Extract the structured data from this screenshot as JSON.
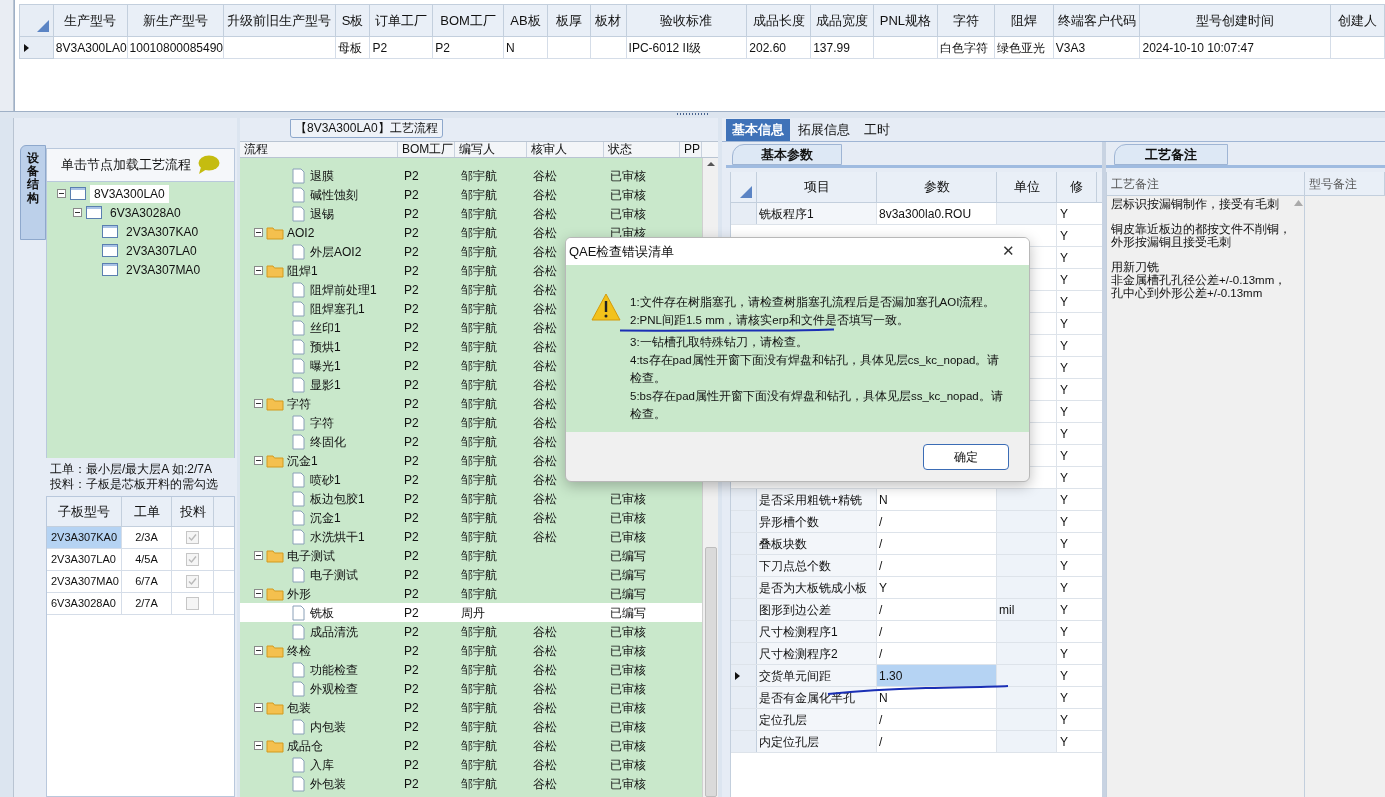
{
  "top_grid": {
    "columns": [
      "生产型号",
      "新生产型号",
      "升级前旧生产型号",
      "S板",
      "订单工厂",
      "BOM工厂",
      "AB板",
      "板厚",
      "板材",
      "验收标准",
      "成品长度",
      "成品宽度",
      "PNL规格",
      "字符",
      "阻焊",
      "终端客户代码",
      "型号创建时间",
      "创建人"
    ],
    "rows": [
      {
        "selected": true,
        "cells": [
          "8V3A300LA0",
          "10010800085490",
          null,
          "母板",
          "P2",
          "P2",
          "N",
          null,
          null,
          "IPC-6012 II级",
          "202.60",
          "137.99",
          null,
          "白色字符",
          "绿色亚光",
          "V3A3",
          "2024-10-10 10:07:47",
          null
        ]
      }
    ]
  },
  "structure": {
    "tab": "设备结构",
    "hint": "单击节点加载工艺流程",
    "tree": [
      {
        "label": "8V3A300LA0",
        "selected": true,
        "expanded": true,
        "children": [
          {
            "label": "6V3A3028A0",
            "selected": false,
            "expanded": true,
            "children": [
              {
                "label": "2V3A307KA0",
                "selected": false
              },
              {
                "label": "2V3A307LA0",
                "selected": false
              },
              {
                "label": "2V3A307MA0",
                "selected": false
              }
            ]
          }
        ]
      }
    ],
    "info": [
      "工单：最小层/最大层A 如:2/7A",
      "投料：子板是芯板开料的需勾选"
    ],
    "grid": {
      "columns": [
        "子板型号",
        "工单",
        "投料"
      ],
      "rows": [
        {
          "model": "2V3A307KA0",
          "order": "2/3A",
          "checked": true,
          "disabled": true,
          "selected": true
        },
        {
          "model": "2V3A307LA0",
          "order": "4/5A",
          "checked": true,
          "disabled": true,
          "selected": false
        },
        {
          "model": "2V3A307MA0",
          "order": "6/7A",
          "checked": true,
          "disabled": true,
          "selected": false
        },
        {
          "model": "6V3A3028A0",
          "order": "2/7A",
          "checked": false,
          "disabled": true,
          "selected": false
        }
      ]
    }
  },
  "process": {
    "title": "【8V3A300LA0】工艺流程",
    "columns": [
      "流程",
      "BOM工厂",
      "编写人",
      "核审人",
      "状态",
      "PP"
    ],
    "groups": [
      {
        "children": [
          {
            "name": "退膜",
            "bom": "P2",
            "author": "邹宇航",
            "reviewer": "谷松",
            "status": "已审核",
            "selected": false
          },
          {
            "name": "碱性蚀刻",
            "bom": "P2",
            "author": "邹宇航",
            "reviewer": "谷松",
            "status": "已审核",
            "selected": false
          },
          {
            "name": "退锡",
            "bom": "P2",
            "author": "邹宇航",
            "reviewer": "谷松",
            "status": "已审核",
            "selected": false
          }
        ]
      },
      {
        "name": "AOI2",
        "expanded": true,
        "bom": "P2",
        "author": "邹宇航",
        "reviewer": "谷松",
        "status": "已审核",
        "selected": false,
        "children": [
          {
            "name": "外层AOI2",
            "bom": "P2",
            "author": "邹宇航",
            "reviewer": "谷松",
            "selected": false
          }
        ]
      },
      {
        "name": "阻焊1",
        "expanded": true,
        "bom": "P2",
        "author": "邹宇航",
        "reviewer": "谷松",
        "selected": false,
        "children": [
          {
            "name": "阻焊前处理1",
            "bom": "P2",
            "author": "邹宇航",
            "reviewer": "谷松",
            "selected": false
          },
          {
            "name": "阻焊塞孔1",
            "bom": "P2",
            "author": "邹宇航",
            "reviewer": "谷松",
            "selected": false
          },
          {
            "name": "丝印1",
            "bom": "P2",
            "author": "邹宇航",
            "reviewer": "谷松",
            "selected": false
          },
          {
            "name": "预烘1",
            "bom": "P2",
            "author": "邹宇航",
            "reviewer": "谷松",
            "selected": false
          },
          {
            "name": "曝光1",
            "bom": "P2",
            "author": "邹宇航",
            "reviewer": "谷松",
            "selected": false
          },
          {
            "name": "显影1",
            "bom": "P2",
            "author": "邹宇航",
            "reviewer": "谷松",
            "selected": false
          }
        ]
      },
      {
        "name": "字符",
        "expanded": true,
        "bom": "P2",
        "author": "邹宇航",
        "reviewer": "谷松",
        "selected": false,
        "children": [
          {
            "name": "字符",
            "bom": "P2",
            "author": "邹宇航",
            "reviewer": "谷松",
            "selected": false
          },
          {
            "name": "终固化",
            "bom": "P2",
            "author": "邹宇航",
            "reviewer": "谷松",
            "selected": false
          }
        ]
      },
      {
        "name": "沉金1",
        "expanded": true,
        "bom": "P2",
        "author": "邹宇航",
        "reviewer": "谷松",
        "selected": false,
        "children": [
          {
            "name": "喷砂1",
            "bom": "P2",
            "author": "邹宇航",
            "reviewer": "谷松",
            "selected": false
          },
          {
            "name": "板边包胶1",
            "bom": "P2",
            "author": "邹宇航",
            "reviewer": "谷松",
            "status": "已审核",
            "selected": false
          },
          {
            "name": "沉金1",
            "bom": "P2",
            "author": "邹宇航",
            "reviewer": "谷松",
            "status": "已审核",
            "selected": false
          },
          {
            "name": "水洗烘干1",
            "bom": "P2",
            "author": "邹宇航",
            "reviewer": "谷松",
            "status": "已审核",
            "selected": false
          }
        ]
      },
      {
        "name": "电子测试",
        "expanded": true,
        "bom": "P2",
        "author": "邹宇航",
        "status": "已编写",
        "selected": false,
        "children": [
          {
            "name": "电子测试",
            "bom": "P2",
            "author": "邹宇航",
            "status": "已编写",
            "selected": false
          }
        ]
      },
      {
        "name": "外形",
        "expanded": true,
        "bom": "P2",
        "author": "邹宇航",
        "status": "已编写",
        "selected": false,
        "children": [
          {
            "name": "铣板",
            "bom": "P2",
            "author": "周丹",
            "status": "已编写",
            "selected": true
          },
          {
            "name": "成品清洗",
            "bom": "P2",
            "author": "邹宇航",
            "reviewer": "谷松",
            "status": "已审核",
            "selected": false
          }
        ]
      },
      {
        "name": "终检",
        "expanded": true,
        "bom": "P2",
        "author": "邹宇航",
        "reviewer": "谷松",
        "status": "已审核",
        "selected": false,
        "children": [
          {
            "name": "功能检查",
            "bom": "P2",
            "author": "邹宇航",
            "reviewer": "谷松",
            "status": "已审核",
            "selected": false
          },
          {
            "name": "外观检查",
            "bom": "P2",
            "author": "邹宇航",
            "reviewer": "谷松",
            "status": "已审核",
            "selected": false
          }
        ]
      },
      {
        "name": "包装",
        "expanded": true,
        "bom": "P2",
        "author": "邹宇航",
        "reviewer": "谷松",
        "status": "已审核",
        "selected": false,
        "children": [
          {
            "name": "内包装",
            "bom": "P2",
            "author": "邹宇航",
            "reviewer": "谷松",
            "status": "已审核",
            "selected": false
          }
        ]
      },
      {
        "name": "成品仓",
        "expanded": true,
        "bom": "P2",
        "author": "邹宇航",
        "reviewer": "谷松",
        "status": "已审核",
        "selected": false,
        "children": [
          {
            "name": "入库",
            "bom": "P2",
            "author": "邹宇航",
            "reviewer": "谷松",
            "status": "已审核",
            "selected": false
          },
          {
            "name": "外包装",
            "bom": "P2",
            "author": "邹宇航",
            "reviewer": "谷松",
            "status": "已审核",
            "selected": false
          }
        ]
      }
    ]
  },
  "right": {
    "tabs": [
      {
        "label": "基本信息",
        "selected": true
      },
      {
        "label": "拓展信息",
        "selected": false
      },
      {
        "label": "工时",
        "selected": false
      }
    ],
    "params": {
      "tab": "基本参数",
      "columns": [
        "项目",
        "参数",
        "单位",
        "修"
      ],
      "rows": [
        {
          "item": "铣板程序1",
          "value": "8v3a300la0.ROU",
          "modify": "Y",
          "selected": false
        },
        {
          "modify": "Y"
        },
        {
          "modify": "Y"
        },
        {
          "modify": "Y"
        },
        {
          "modify": "Y"
        },
        {
          "modify": "Y"
        },
        {
          "modify": "Y"
        },
        {
          "modify": "Y"
        },
        {
          "modify": "Y"
        },
        {
          "modify": "Y"
        },
        {
          "modify": "Y"
        },
        {
          "modify": "Y"
        },
        {
          "modify": "Y"
        },
        {
          "item": "是否采用粗铣+精铣",
          "value": "N",
          "modify": "Y",
          "selected": false
        },
        {
          "item": "异形槽个数",
          "value": "/",
          "modify": "Y",
          "selected": false
        },
        {
          "item": "叠板块数",
          "value": "/",
          "modify": "Y",
          "selected": false
        },
        {
          "item": "下刀点总个数",
          "value": "/",
          "modify": "Y",
          "selected": false
        },
        {
          "item": "是否为大板铣成小板",
          "value": "Y",
          "modify": "Y",
          "selected": false
        },
        {
          "item": "图形到边公差",
          "value": "/",
          "unit": "mil",
          "modify": "Y",
          "selected": false
        },
        {
          "item": "尺寸检测程序1",
          "value": "/",
          "modify": "Y",
          "selected": false
        },
        {
          "item": "尺寸检测程序2",
          "value": "/",
          "modify": "Y",
          "selected": false
        },
        {
          "item": "交货单元间距",
          "value": "1.30",
          "modify": "Y",
          "selected": true
        },
        {
          "item": "是否有金属化半孔",
          "value": "N",
          "modify": "Y",
          "selected": false
        },
        {
          "item": "定位孔层",
          "value": "/",
          "modify": "Y",
          "selected": false
        },
        {
          "item": "内定位孔层",
          "value": "/",
          "modify": "Y",
          "selected": false
        }
      ]
    },
    "notes": {
      "tab": "工艺备注",
      "columns": [
        "工艺备注",
        "型号备注"
      ],
      "paragraphs": [
        [
          "层标识按漏铜制作，接受有毛刺"
        ],
        [
          "铜皮靠近板边的都按文件不削铜，外形按漏铜且接受毛刺"
        ],
        [
          "用新刀铣",
          "非金属槽孔孔径公差+/-0.13mm，",
          "孔中心到外形公差+/-0.13mm"
        ]
      ]
    }
  },
  "dialog": {
    "title": "QAE检查错误清单",
    "close": "✕",
    "messages": [
      "1:文件存在树脂塞孔，请检查树脂塞孔流程后是否漏加塞孔AOI流程。",
      "2:PNL间距1.5 mm，请核实erp和文件是否填写一致。",
      "3:一钻槽孔取特殊钻刀，请检查。",
      "4:ts存在pad属性开窗下面没有焊盘和钻孔，具体见层cs_kc_nopad。请检查。",
      "5:bs存在pad属性开窗下面没有焊盘和钻孔，具体见层ss_kc_nopad。请检查。"
    ],
    "button": "确定"
  }
}
